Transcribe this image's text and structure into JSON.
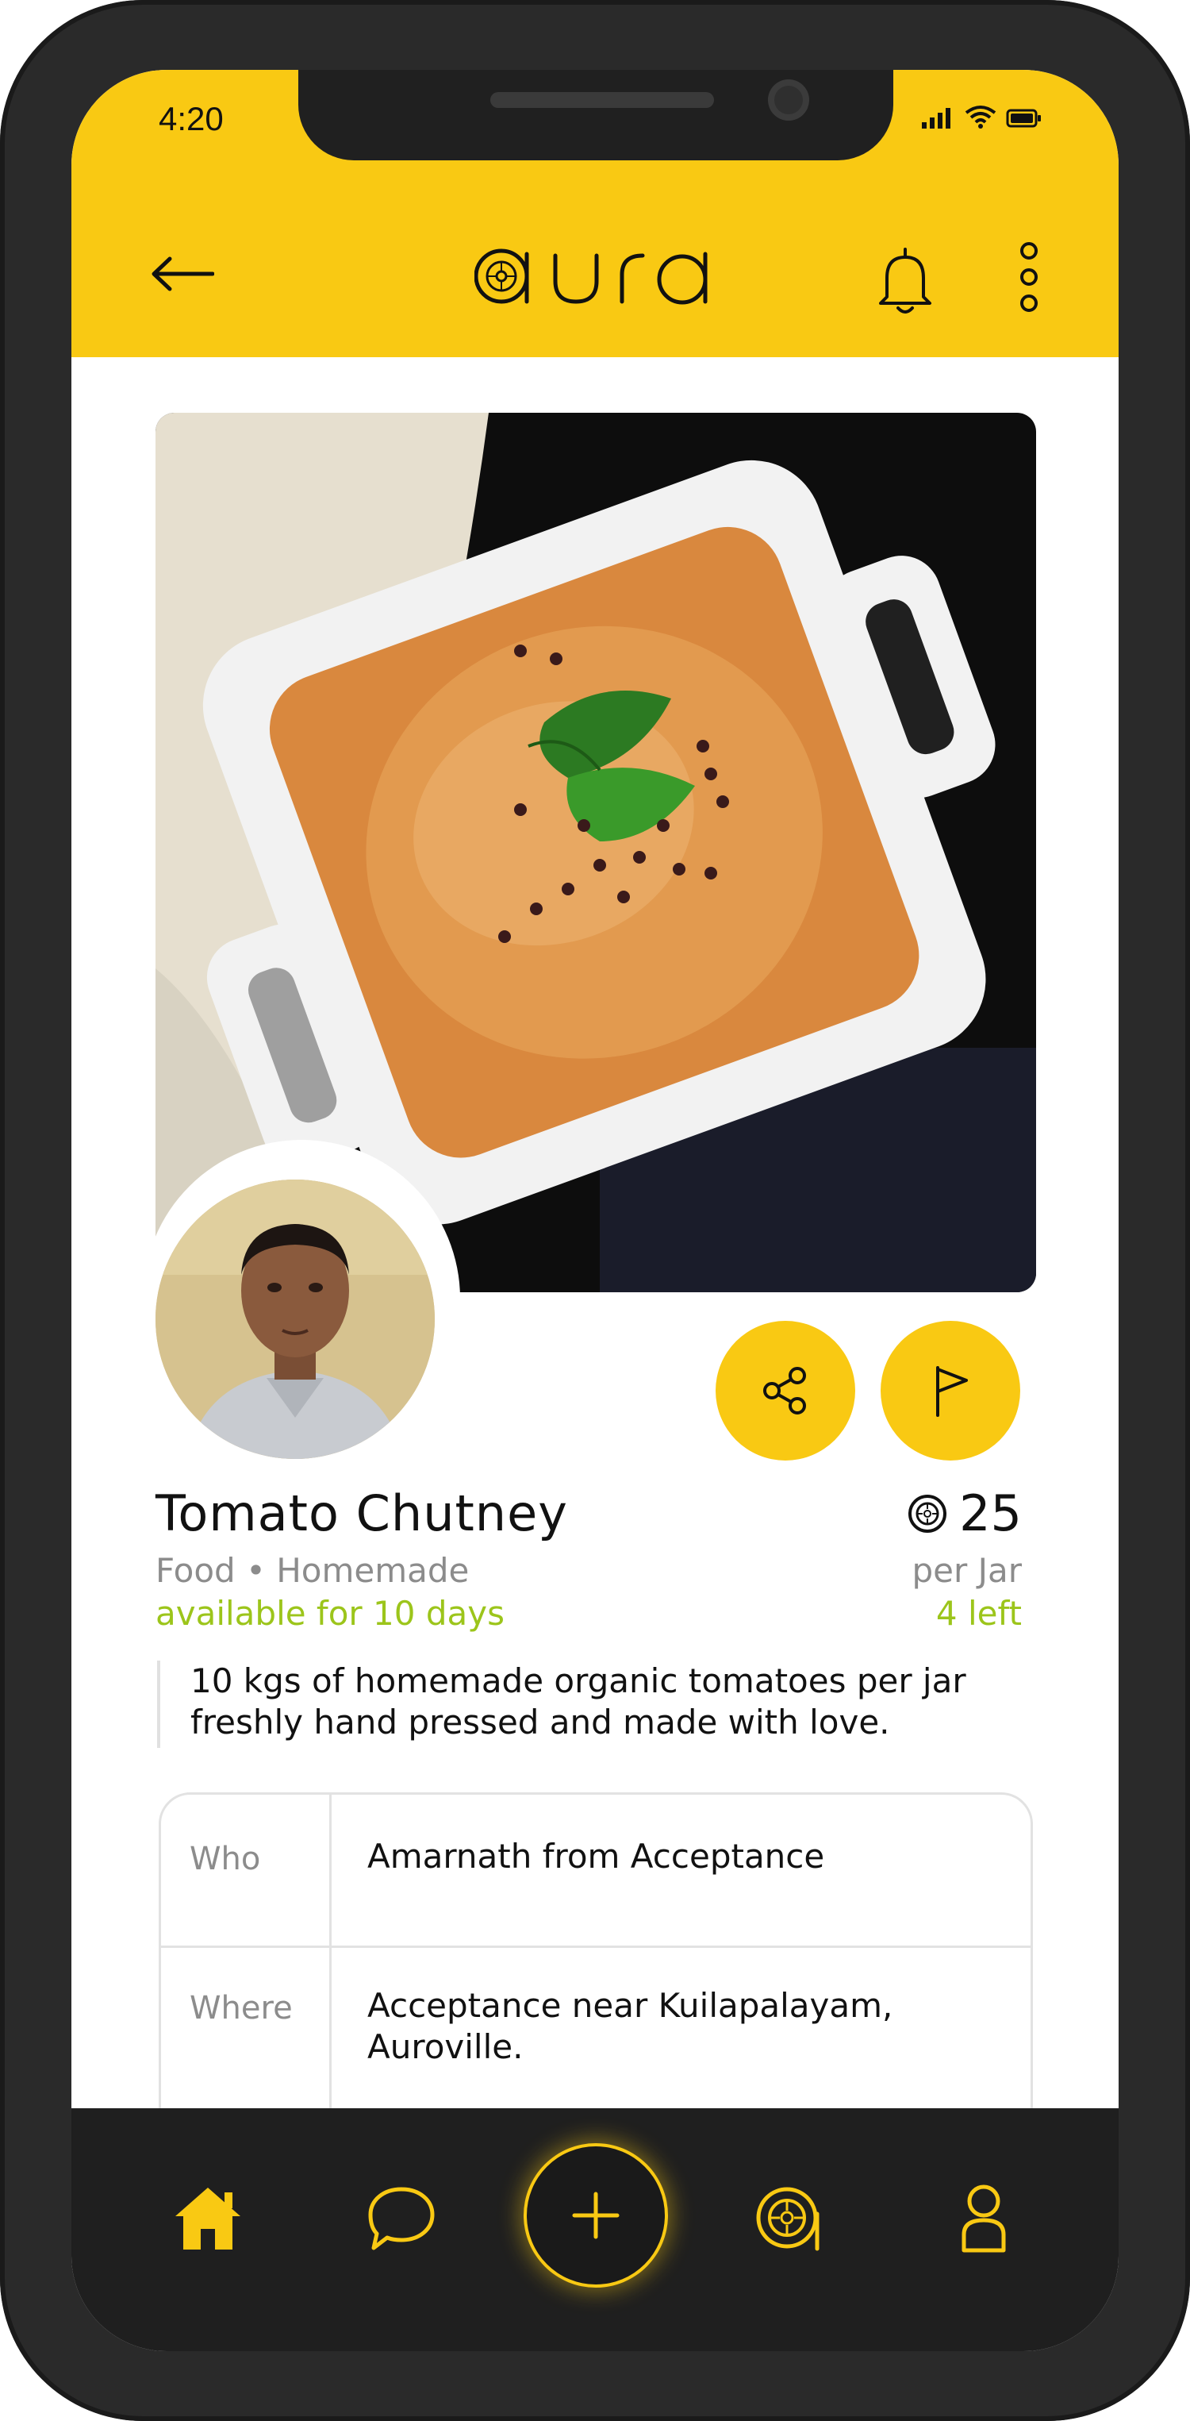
{
  "status_bar": {
    "time": "4:20"
  },
  "header": {
    "logo_text": "aura",
    "icons": [
      "back-arrow-icon",
      "bell-icon",
      "kebab-menu-icon"
    ]
  },
  "product": {
    "title": "Tomato Chutney",
    "category": "Food • Homemade",
    "availability": "available for 10 days",
    "price": "25",
    "unit": "per Jar",
    "stock": "4 left",
    "description_line1": "10 kgs of homemade organic tomatoes per jar",
    "description_line2": "freshly hand pressed and made with love."
  },
  "actions": {
    "icons": [
      "share-icon",
      "flag-icon"
    ]
  },
  "details": [
    {
      "key": "Who",
      "value_line1": "Amarnath from Acceptance",
      "value_line2": ""
    },
    {
      "key": "Where",
      "value_line1": "Acceptance near Kuilapalayam,",
      "value_line2": "Auroville."
    }
  ],
  "bottom_nav": {
    "items": [
      "home-icon",
      "chat-icon",
      "add-icon",
      "aura-icon",
      "profile-icon"
    ],
    "accent": "#f9c913"
  },
  "colors": {
    "accent": "#f9c913",
    "availability_green": "#9cc51b",
    "muted_text": "#8c8c8c",
    "dark": "#1f1f1f"
  }
}
